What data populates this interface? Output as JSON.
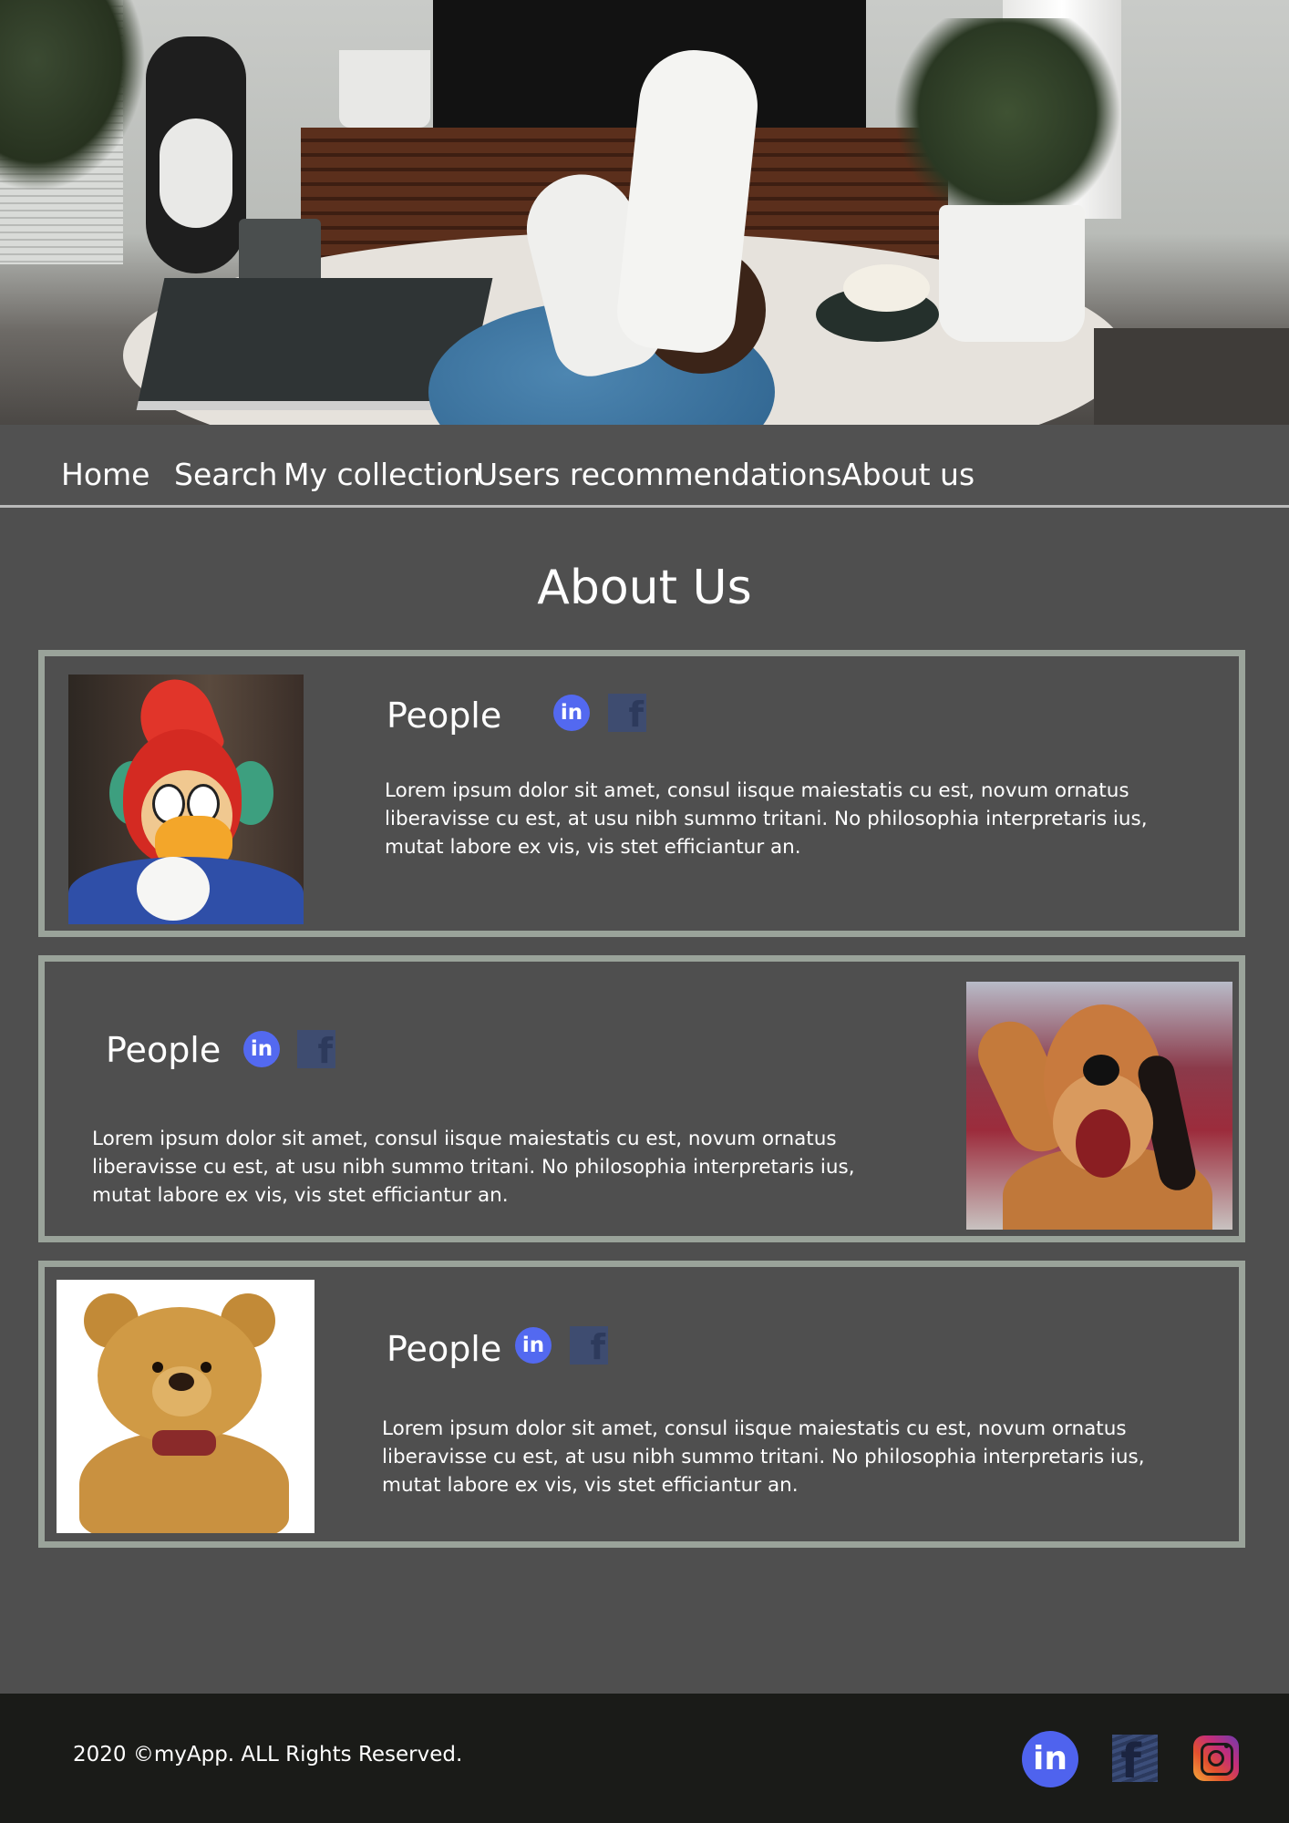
{
  "nav": {
    "items": [
      {
        "label": "Home"
      },
      {
        "label": "Search"
      },
      {
        "label": "My collection"
      },
      {
        "label": "Users recommendations"
      },
      {
        "label": "About us"
      }
    ]
  },
  "main": {
    "title": "About Us",
    "cards": [
      {
        "name": "People",
        "text": "Lorem ipsum dolor sit amet, consul iisque maiestatis cu est, novum ornatus liberavisse cu est, at usu nibh summo tritani. No philosophia interpretaris ius, mutat labore ex vis, vis stet efficiantur an.",
        "linkedin_icon": "linkedin-icon",
        "facebook_icon": "facebook-icon",
        "photo": "woodpecker-mascot-photo"
      },
      {
        "name": "People",
        "text": "Lorem ipsum dolor sit amet, consul iisque maiestatis cu est, novum ornatus liberavisse cu est, at usu nibh summo tritani. No philosophia interpretaris ius, mutat labore ex vis, vis stet efficiantur an.",
        "linkedin_icon": "linkedin-icon",
        "facebook_icon": "facebook-icon",
        "photo": "dog-mascot-photo"
      },
      {
        "name": "People",
        "text": "Lorem ipsum dolor sit amet, consul iisque maiestatis cu est, novum ornatus liberavisse cu est, at usu nibh summo tritani. No philosophia interpretaris ius, mutat labore ex vis, vis stet efficiantur an.",
        "linkedin_icon": "linkedin-icon",
        "facebook_icon": "facebook-icon",
        "photo": "teddy-bear-photo"
      }
    ]
  },
  "footer": {
    "copyright": "2020 ©myApp. ALL Rights Reserved.",
    "icons": [
      "linkedin-icon",
      "facebook-icon",
      "instagram-icon"
    ]
  },
  "colors": {
    "background": "#4f4f4f",
    "card_border": "#9aa39a",
    "linkedin": "#5369f0",
    "facebook": "#3e4c70",
    "footer": "#1a1b18"
  }
}
